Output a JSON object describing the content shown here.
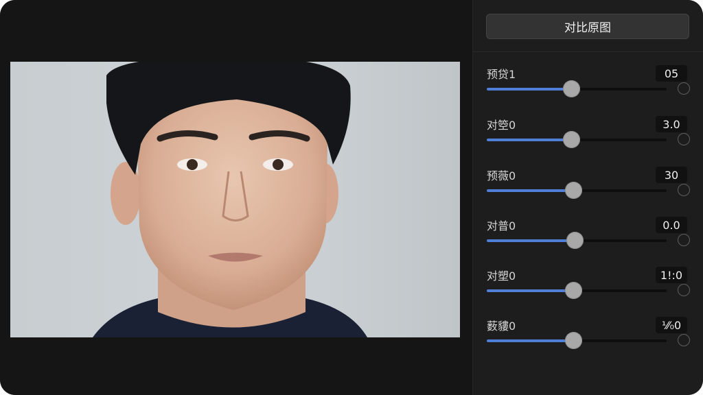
{
  "toolbar": {
    "compare_label": "对比原图"
  },
  "photo": {
    "subject": "portrait-photo"
  },
  "sliders": [
    {
      "label": "预贷1",
      "value": "05",
      "level": 0.47
    },
    {
      "label": "对箜0",
      "value": "3.0",
      "level": 0.47
    },
    {
      "label": "预薇0",
      "value": "30",
      "level": 0.48
    },
    {
      "label": "对普0",
      "value": "0.0",
      "level": 0.49
    },
    {
      "label": "对塑0",
      "value": "1!:0",
      "level": 0.48
    },
    {
      "label": "薮貗0",
      "value": "⅟⁄₀0",
      "level": 0.48
    }
  ],
  "colors": {
    "accent": "#4f7fd6",
    "panel": "#1d1d1d",
    "canvas": "#151515"
  }
}
